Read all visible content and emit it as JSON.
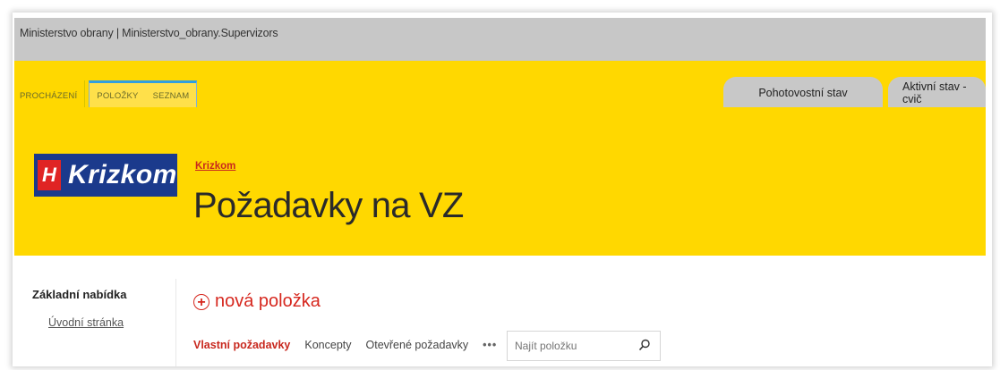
{
  "topbar": {
    "site_title": "Ministerstvo obrany | Ministerstvo_obrany.Supervizors"
  },
  "ribbon": {
    "tabs": [
      {
        "label": "PROCHÁZENÍ"
      },
      {
        "label": "POLOŽKY"
      },
      {
        "label": "SEZNAM"
      }
    ]
  },
  "status_buttons": [
    {
      "label": "Pohotovostní stav"
    },
    {
      "label": "Aktivní stav - cvič"
    }
  ],
  "header": {
    "logo_mark": "H",
    "logo_text": "Krizkom",
    "breadcrumb": "Krizkom",
    "page_title": "Požadavky na VZ"
  },
  "quick_launch": {
    "title": "Základní nabídka",
    "links": [
      {
        "label": "Úvodní stránka"
      }
    ]
  },
  "list": {
    "new_item_label": "nová položka",
    "views": [
      {
        "label": "Vlastní požadavky"
      },
      {
        "label": "Koncepty"
      },
      {
        "label": "Otevřené požadavky"
      }
    ],
    "more_label": "•••",
    "search_placeholder": "Najít položku"
  },
  "colors": {
    "brand_yellow": "#ffd800",
    "accent_red": "#d6271e",
    "logo_blue": "#1b3a8c"
  }
}
